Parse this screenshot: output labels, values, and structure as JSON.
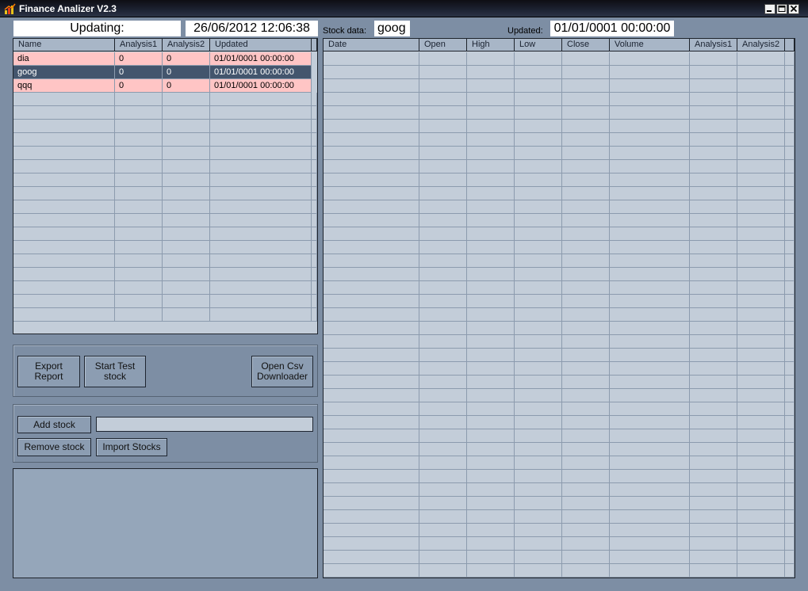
{
  "window": {
    "title": "Finance Analizer V2.3",
    "minimize": "▁",
    "maximize": "□",
    "close": "✕"
  },
  "header": {
    "updating_label": "Updating:",
    "datetime": "26/06/2012 12:06:38",
    "stock_data_label": "Stock data:",
    "stock_value": "goog",
    "updated_label": "Updated:",
    "updated_value": "01/01/0001 00:00:00"
  },
  "stocks_grid": {
    "columns": [
      "Name",
      "Analysis1",
      "Analysis2",
      "Updated"
    ],
    "rows": [
      {
        "name": "dia",
        "analysis1": "0",
        "analysis2": "0",
        "updated": "01/01/0001 00:00:00",
        "state": "pink"
      },
      {
        "name": "goog",
        "analysis1": "0",
        "analysis2": "0",
        "updated": "01/01/0001 00:00:00",
        "state": "selected"
      },
      {
        "name": "qqq",
        "analysis1": "0",
        "analysis2": "0",
        "updated": "01/01/0001 00:00:00",
        "state": "pink"
      }
    ]
  },
  "data_grid": {
    "columns": [
      "Date",
      "Open",
      "High",
      "Low",
      "Close",
      "Volume",
      "Analysis1",
      "Analysis2"
    ]
  },
  "actions": {
    "export_report": "Export\nReport",
    "start_test_stock": "Start Test\nstock",
    "open_csv_downloader": "Open Csv\nDownloader"
  },
  "stock_management": {
    "add_stock": "Add stock",
    "remove_stock": "Remove stock",
    "import_stocks": "Import Stocks",
    "input_value": ""
  },
  "colors": {
    "background": "#7d8ea4",
    "grid": "#c3cdd9",
    "highlight_row": "#ffc5c5",
    "selected_row": "#43556d"
  }
}
